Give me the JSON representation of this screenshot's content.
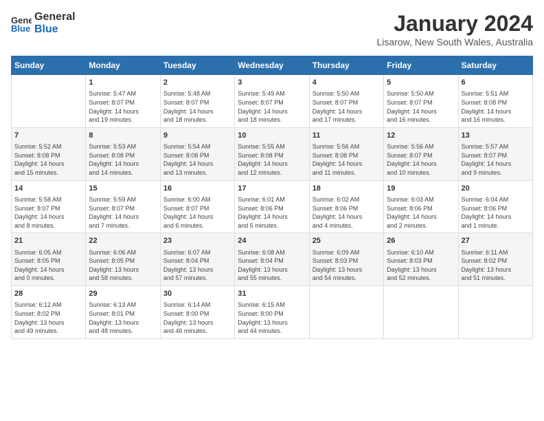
{
  "logo": {
    "general": "General",
    "blue": "Blue"
  },
  "title": "January 2024",
  "location": "Lisarow, New South Wales, Australia",
  "headers": [
    "Sunday",
    "Monday",
    "Tuesday",
    "Wednesday",
    "Thursday",
    "Friday",
    "Saturday"
  ],
  "weeks": [
    [
      {
        "day": "",
        "info": ""
      },
      {
        "day": "1",
        "info": "Sunrise: 5:47 AM\nSunset: 8:07 PM\nDaylight: 14 hours\nand 19 minutes."
      },
      {
        "day": "2",
        "info": "Sunrise: 5:48 AM\nSunset: 8:07 PM\nDaylight: 14 hours\nand 18 minutes."
      },
      {
        "day": "3",
        "info": "Sunrise: 5:49 AM\nSunset: 8:07 PM\nDaylight: 14 hours\nand 18 minutes."
      },
      {
        "day": "4",
        "info": "Sunrise: 5:50 AM\nSunset: 8:07 PM\nDaylight: 14 hours\nand 17 minutes."
      },
      {
        "day": "5",
        "info": "Sunrise: 5:50 AM\nSunset: 8:07 PM\nDaylight: 14 hours\nand 16 minutes."
      },
      {
        "day": "6",
        "info": "Sunrise: 5:51 AM\nSunset: 8:08 PM\nDaylight: 14 hours\nand 16 minutes."
      }
    ],
    [
      {
        "day": "7",
        "info": "Sunrise: 5:52 AM\nSunset: 8:08 PM\nDaylight: 14 hours\nand 15 minutes."
      },
      {
        "day": "8",
        "info": "Sunrise: 5:53 AM\nSunset: 8:08 PM\nDaylight: 14 hours\nand 14 minutes."
      },
      {
        "day": "9",
        "info": "Sunrise: 5:54 AM\nSunset: 8:08 PM\nDaylight: 14 hours\nand 13 minutes."
      },
      {
        "day": "10",
        "info": "Sunrise: 5:55 AM\nSunset: 8:08 PM\nDaylight: 14 hours\nand 12 minutes."
      },
      {
        "day": "11",
        "info": "Sunrise: 5:56 AM\nSunset: 8:08 PM\nDaylight: 14 hours\nand 11 minutes."
      },
      {
        "day": "12",
        "info": "Sunrise: 5:56 AM\nSunset: 8:07 PM\nDaylight: 14 hours\nand 10 minutes."
      },
      {
        "day": "13",
        "info": "Sunrise: 5:57 AM\nSunset: 8:07 PM\nDaylight: 14 hours\nand 9 minutes."
      }
    ],
    [
      {
        "day": "14",
        "info": "Sunrise: 5:58 AM\nSunset: 8:07 PM\nDaylight: 14 hours\nand 8 minutes."
      },
      {
        "day": "15",
        "info": "Sunrise: 5:59 AM\nSunset: 8:07 PM\nDaylight: 14 hours\nand 7 minutes."
      },
      {
        "day": "16",
        "info": "Sunrise: 6:00 AM\nSunset: 8:07 PM\nDaylight: 14 hours\nand 6 minutes."
      },
      {
        "day": "17",
        "info": "Sunrise: 6:01 AM\nSunset: 8:06 PM\nDaylight: 14 hours\nand 5 minutes."
      },
      {
        "day": "18",
        "info": "Sunrise: 6:02 AM\nSunset: 8:06 PM\nDaylight: 14 hours\nand 4 minutes."
      },
      {
        "day": "19",
        "info": "Sunrise: 6:03 AM\nSunset: 8:06 PM\nDaylight: 14 hours\nand 2 minutes."
      },
      {
        "day": "20",
        "info": "Sunrise: 6:04 AM\nSunset: 8:06 PM\nDaylight: 14 hours\nand 1 minute."
      }
    ],
    [
      {
        "day": "21",
        "info": "Sunrise: 6:05 AM\nSunset: 8:05 PM\nDaylight: 14 hours\nand 0 minutes."
      },
      {
        "day": "22",
        "info": "Sunrise: 6:06 AM\nSunset: 8:05 PM\nDaylight: 13 hours\nand 58 minutes."
      },
      {
        "day": "23",
        "info": "Sunrise: 6:07 AM\nSunset: 8:04 PM\nDaylight: 13 hours\nand 57 minutes."
      },
      {
        "day": "24",
        "info": "Sunrise: 6:08 AM\nSunset: 8:04 PM\nDaylight: 13 hours\nand 55 minutes."
      },
      {
        "day": "25",
        "info": "Sunrise: 6:09 AM\nSunset: 8:03 PM\nDaylight: 13 hours\nand 54 minutes."
      },
      {
        "day": "26",
        "info": "Sunrise: 6:10 AM\nSunset: 8:03 PM\nDaylight: 13 hours\nand 52 minutes."
      },
      {
        "day": "27",
        "info": "Sunrise: 6:11 AM\nSunset: 8:02 PM\nDaylight: 13 hours\nand 51 minutes."
      }
    ],
    [
      {
        "day": "28",
        "info": "Sunrise: 6:12 AM\nSunset: 8:02 PM\nDaylight: 13 hours\nand 49 minutes."
      },
      {
        "day": "29",
        "info": "Sunrise: 6:13 AM\nSunset: 8:01 PM\nDaylight: 13 hours\nand 48 minutes."
      },
      {
        "day": "30",
        "info": "Sunrise: 6:14 AM\nSunset: 8:00 PM\nDaylight: 13 hours\nand 46 minutes."
      },
      {
        "day": "31",
        "info": "Sunrise: 6:15 AM\nSunset: 8:00 PM\nDaylight: 13 hours\nand 44 minutes."
      },
      {
        "day": "",
        "info": ""
      },
      {
        "day": "",
        "info": ""
      },
      {
        "day": "",
        "info": ""
      }
    ]
  ]
}
